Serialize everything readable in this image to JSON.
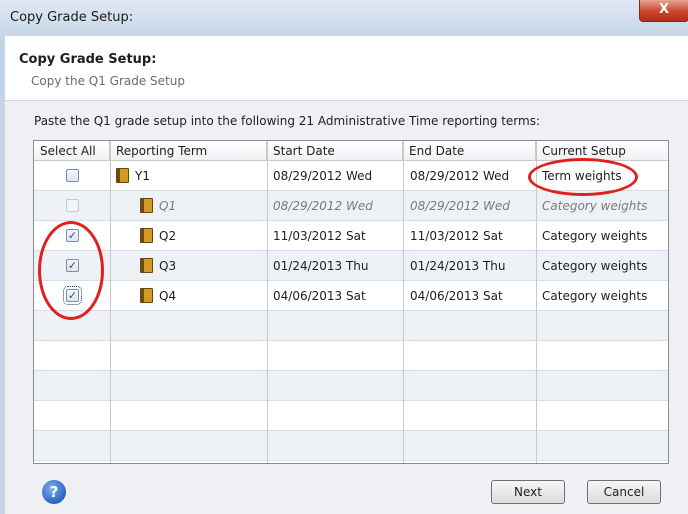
{
  "window": {
    "title": "Copy Grade Setup:",
    "close_label": "X"
  },
  "header": {
    "title": "Copy Grade Setup:",
    "subtitle": "Copy the Q1 Grade Setup"
  },
  "instruction": "Paste the Q1 grade setup into the following 21 Administrative Time reporting terms:",
  "table": {
    "columns": [
      "Select All",
      "Reporting Term",
      "Start Date",
      "End Date",
      "Current Setup"
    ],
    "rows": [
      {
        "checked": false,
        "disabled": false,
        "term": "Y1",
        "start": "08/29/2012 Wed",
        "end": "08/29/2012 Wed",
        "setup": "Term weights"
      },
      {
        "checked": false,
        "disabled": true,
        "term": "Q1",
        "start": "08/29/2012 Wed",
        "end": "08/29/2012 Wed",
        "setup": "Category weights"
      },
      {
        "checked": true,
        "disabled": false,
        "term": "Q2",
        "start": "11/03/2012 Sat",
        "end": "11/03/2012 Sat",
        "setup": "Category weights"
      },
      {
        "checked": true,
        "disabled": false,
        "term": "Q3",
        "start": "01/24/2013 Thu",
        "end": "01/24/2013 Thu",
        "setup": "Category weights"
      },
      {
        "checked": true,
        "disabled": false,
        "term": "Q4",
        "start": "04/06/2013 Sat",
        "end": "04/06/2013 Sat",
        "setup": "Category weights"
      }
    ]
  },
  "buttons": {
    "next": "Next",
    "cancel": "Cancel",
    "help": "?"
  },
  "colors": {
    "annotation": "#e0201c",
    "accent": "#2a62c4"
  },
  "icons": {
    "term": "book-icon",
    "help": "help-icon",
    "close": "close-icon"
  }
}
